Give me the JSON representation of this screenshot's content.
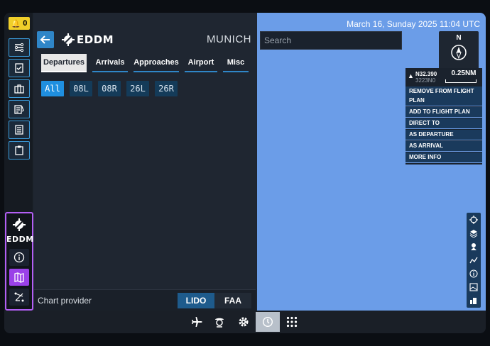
{
  "notification": {
    "count": "0",
    "icon": "bell-icon"
  },
  "rail": {
    "buttons": [
      "route-icon",
      "checklist-icon",
      "briefcase-icon",
      "flight-plan-icon",
      "notes-icon",
      "clipboard-icon"
    ],
    "airport": {
      "label": "EDDM",
      "icon": "airport-icon"
    },
    "airport_buttons": [
      "info-icon",
      "map-icon",
      "route-map-icon"
    ]
  },
  "panel": {
    "icao": "EDDM",
    "city": "MUNICH",
    "tabs": [
      {
        "label": "Departures",
        "active": true
      },
      {
        "label": "Arrivals",
        "active": false
      },
      {
        "label": "Approaches",
        "active": false
      },
      {
        "label": "Airport",
        "active": false
      },
      {
        "label": "Misc",
        "active": false
      }
    ],
    "runways": [
      {
        "label": "All",
        "active": true
      },
      {
        "label": "08L",
        "active": false
      },
      {
        "label": "08R",
        "active": false
      },
      {
        "label": "26L",
        "active": false
      },
      {
        "label": "26R",
        "active": false
      }
    ],
    "provider": {
      "label": "Chart provider",
      "options": [
        "LIDO",
        "FAA"
      ],
      "selected": "LIDO"
    }
  },
  "map": {
    "datetime": "March 16, Sunday 2025 11:04 UTC",
    "search_placeholder": "Search",
    "compass_label": "N",
    "context": {
      "coord_line1": "N32.390",
      "coord_line2": "3223N0",
      "scale": "0.25NM",
      "items": [
        "REMOVE FROM FLIGHT PLAN",
        "ADD TO FLIGHT PLAN",
        "DIRECT TO",
        "AS DEPARTURE",
        "AS ARRIVAL",
        "MORE INFO"
      ]
    },
    "tools": [
      "crosshair-icon",
      "layers-icon",
      "pin-icon",
      "elevation-icon",
      "info-icon",
      "terrain-icon",
      "chart-icon"
    ]
  },
  "bottom_bar": {
    "buttons": [
      {
        "icon": "airplane-icon",
        "active": false
      },
      {
        "icon": "pilot-icon",
        "active": false
      },
      {
        "icon": "gear-icon",
        "active": false
      },
      {
        "icon": "clock-icon",
        "active": true
      },
      {
        "icon": "apps-grid-icon",
        "active": false
      }
    ]
  },
  "colors": {
    "accent": "#2f86c8",
    "purple": "#9b41e8",
    "map": "#6b9de8",
    "warning": "#f0cf2a"
  }
}
